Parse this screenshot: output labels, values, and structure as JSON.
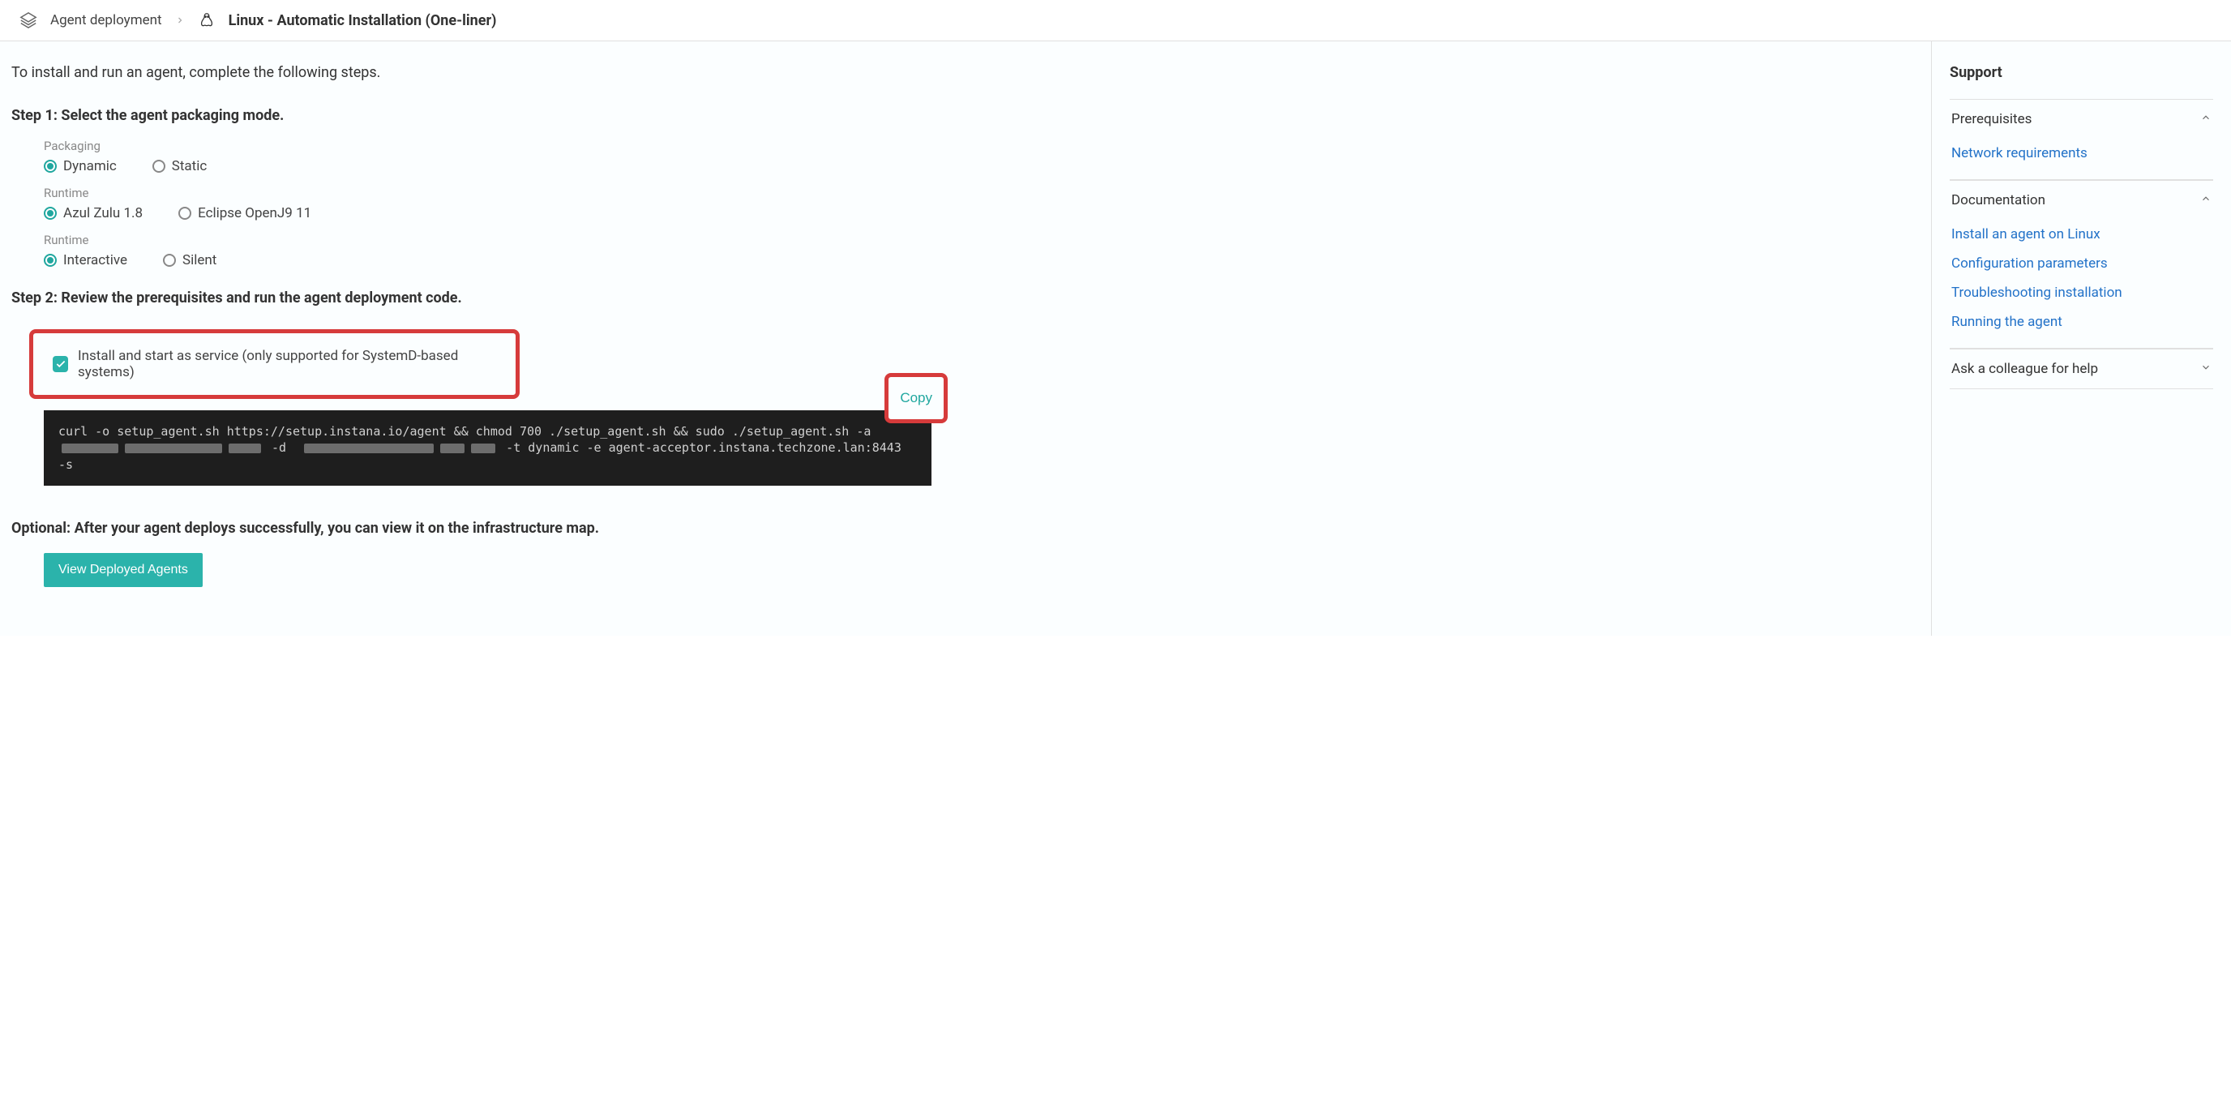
{
  "breadcrumb": {
    "parent": "Agent deployment",
    "title": "Linux - Automatic Installation (One-liner)"
  },
  "intro": "To install and run an agent, complete the following steps.",
  "step1": {
    "title": "Step 1: Select the agent packaging mode.",
    "groups": [
      {
        "label": "Packaging",
        "options": [
          "Dynamic",
          "Static"
        ],
        "selected": 0
      },
      {
        "label": "Runtime",
        "options": [
          "Azul Zulu 1.8",
          "Eclipse OpenJ9 11"
        ],
        "selected": 0
      },
      {
        "label": "Runtime",
        "options": [
          "Interactive",
          "Silent"
        ],
        "selected": 0
      }
    ]
  },
  "step2": {
    "title": "Step 2: Review the prerequisites and run the agent deployment code.",
    "checkbox_label": "Install and start as service (only supported for SystemD-based systems)",
    "checkbox_checked": true,
    "copy_button": "Copy",
    "code": {
      "seg1": "curl -o setup_agent.sh https://setup.instana.io/agent && chmod 700 ./setup_agent.sh && sudo ./setup_agent.sh -a ",
      "seg2": " -d ",
      "seg3": " -t dynamic -e agent-acceptor.instana.techzone.lan:8443   -s"
    }
  },
  "optional": {
    "title": "Optional: After your agent deploys successfully, you can view it on the infrastructure map.",
    "button": "View Deployed Agents"
  },
  "sidebar": {
    "title": "Support",
    "sections": [
      {
        "heading": "Prerequisites",
        "expanded": true,
        "links": [
          "Network requirements"
        ]
      },
      {
        "heading": "Documentation",
        "expanded": true,
        "links": [
          "Install an agent on Linux",
          "Configuration parameters",
          "Troubleshooting installation",
          "Running the agent"
        ]
      },
      {
        "heading": "Ask a colleague for help",
        "expanded": false,
        "links": []
      }
    ]
  }
}
